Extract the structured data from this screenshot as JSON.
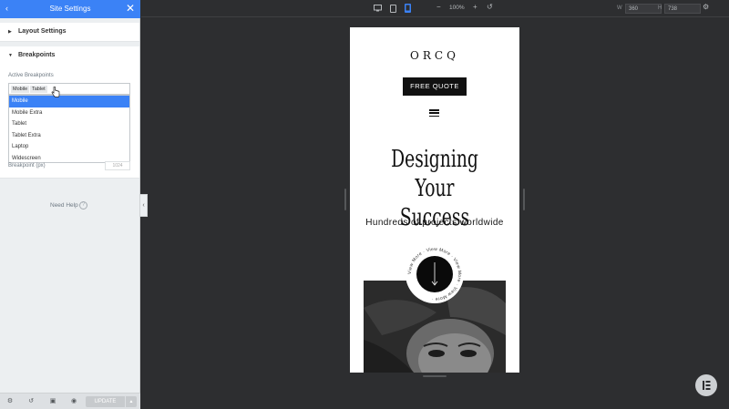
{
  "panel": {
    "title": "Site Settings",
    "back_icon": "chevron-left-icon",
    "close_icon": "close-icon",
    "sections": {
      "layout": {
        "title": "Layout Settings"
      },
      "breakpoints": {
        "title": "Breakpoints",
        "active_label": "Active Breakpoints",
        "selected_chips": [
          "Mobile",
          "Tablet"
        ],
        "options": [
          "Mobile",
          "Mobile Extra",
          "Tablet",
          "Tablet Extra",
          "Laptop",
          "Widescreen"
        ],
        "highlighted_option": "Mobile",
        "breakpoint_label": "Breakpoint (px)",
        "breakpoint_value": "1024"
      }
    },
    "need_help": "Need Help",
    "help_icon": "?",
    "footer": {
      "update_label": "UPDATE",
      "icons": [
        "gear-icon",
        "history-icon",
        "responsive-icon",
        "eye-icon"
      ]
    }
  },
  "toolbar": {
    "zoom": "100%",
    "width_label": "W",
    "width_value": "360",
    "height_label": "H",
    "height_value": "738",
    "icons": [
      "desktop-icon",
      "tablet-icon",
      "mobile-icon",
      "zoom-out-icon",
      "zoom-in-icon",
      "reset-icon",
      "gear-icon"
    ]
  },
  "preview": {
    "logo": "ORCQ",
    "cta": "FREE QUOTE",
    "headline": [
      "Designing Your",
      "Success"
    ],
    "subheadline": "Hundreds of projects worldwide",
    "badge_text": "View More · View More · View More · View More · "
  },
  "colors": {
    "accent": "#3b82f6",
    "canvas": "#2d2e30",
    "panel": "#eceff1"
  }
}
